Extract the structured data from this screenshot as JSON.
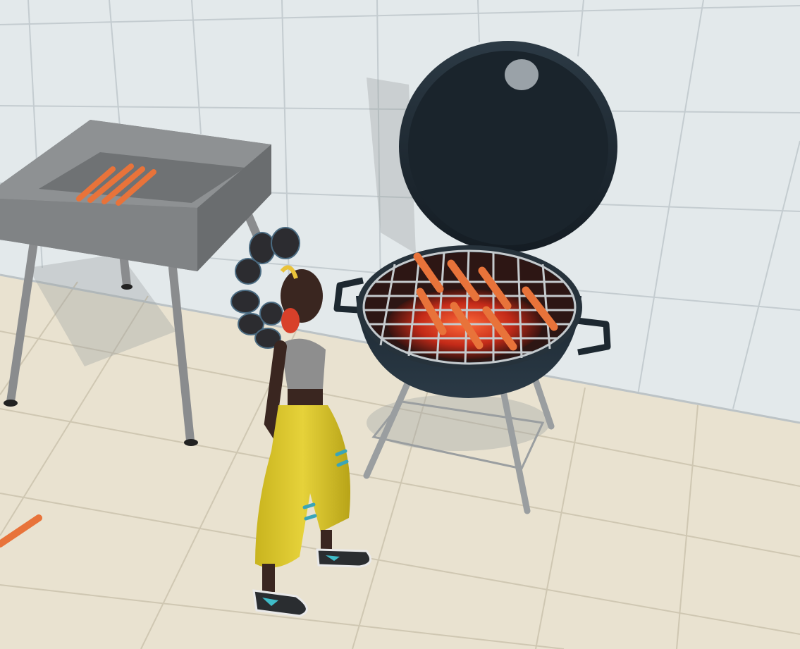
{
  "scene": {
    "type": "3d-game-viewport",
    "setting": "tiled-kitchen",
    "objects": {
      "tray": {
        "name": "sausage-tray",
        "sausage_count": 4
      },
      "grill": {
        "name": "kettle-grill",
        "lid": "open",
        "coals": "glowing",
        "sausage_count": 7
      },
      "character": {
        "name": "player-character",
        "accessory": "headphones",
        "outfit": "yellow-pants"
      },
      "loose_items": [
        {
          "name": "sausage",
          "location": "floor"
        }
      ]
    },
    "colors": {
      "wall_tile": "#e6ecee",
      "floor_tile": "#e8e1cf",
      "grill_body": "#1f2c35",
      "tray_metal": "#7f8284",
      "sausage": "#e8733a",
      "coals": "#d8381e",
      "pants": "#e0cb2b"
    }
  }
}
